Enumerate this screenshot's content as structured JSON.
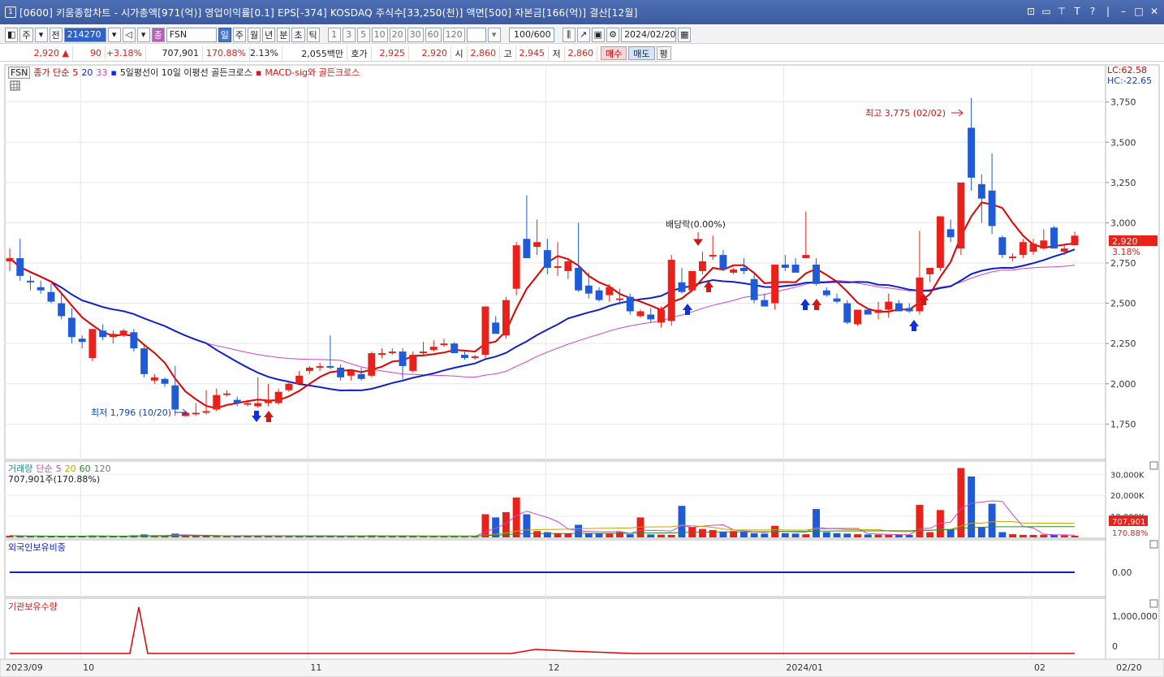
{
  "window": {
    "icon_label": "1",
    "title": "[0600] 키움종합차트 - 시가총액[971(억)] 영업이익률[0.1] EPS[-374] KOSDAQ 주식수[33,250(천)] 액면[500] 자본금[166(억)] 결산[12월]"
  },
  "toolbar": {
    "period_label": "주",
    "prev_label": "전",
    "code_value": "214270",
    "stock_badge": "종",
    "stock_name": "FSN",
    "periods": [
      "일",
      "주",
      "월",
      "년",
      "분",
      "초",
      "틱"
    ],
    "active_period": "일",
    "intervals": [
      "1",
      "3",
      "5",
      "10",
      "20",
      "30",
      "60",
      "120"
    ],
    "count_value": "100/600",
    "date_value": "2024/02/20"
  },
  "pricebar": {
    "price": "2,920",
    "change": "90",
    "change_pct": "+3.18%",
    "volume": "707,901",
    "volume_ratio": "170.88%",
    "turnover": "2.13%",
    "amount": "2,055백만",
    "quote_label": "호가",
    "ask": "2,925",
    "bid": "2,920",
    "open_label": "시",
    "open": "2,860",
    "high_label": "고",
    "high": "2,945",
    "low_label": "저",
    "low": "2,860",
    "buy_label": "매수",
    "sell_label": "매도",
    "flat_label": "평"
  },
  "price_panel": {
    "ticker": "FSN",
    "ma_label": "종가 단순",
    "ma_periods": [
      "5",
      "20",
      "33"
    ],
    "signal1": "5일평선이 10일 이평선 골든크로스",
    "signal2": "MACD-sig와 골든크로스",
    "lc": "LC:62.58",
    "hc": "HC:-22.65",
    "high_annotation": "최고 3,775 (02/02)",
    "low_annotation": "최저 1,796 (10/20)",
    "dividend_annotation": "배당락(0.00%)",
    "current_label": "2,920",
    "current_pct": "3.18%"
  },
  "volume_panel": {
    "title": "거래량",
    "ma_label": "단순",
    "ma_periods": [
      "5",
      "20",
      "60",
      "120"
    ],
    "summary": "707,901주(170.88%)",
    "current_label": "707,901",
    "current_pct": "170.88%"
  },
  "foreign_panel": {
    "title": "외국인보유비중"
  },
  "inst_panel": {
    "title": "기관보유수량"
  },
  "x_axis": {
    "labels": [
      "2023/09",
      "10",
      "11",
      "12",
      "2024/01",
      "02",
      "02/20"
    ]
  },
  "colors": {
    "up": "#e8211a",
    "down": "#1f5bd6",
    "ma5": "#e00000",
    "ma20": "#1020c8",
    "ma33": "#cc44cc",
    "title_bg": "#3b5aa0"
  },
  "chart_data": {
    "type": "candlestick",
    "price_axis": {
      "ticks": [
        "1,750",
        "2,000",
        "2,250",
        "2,500",
        "2,750",
        "3,000",
        "3,250",
        "3,500",
        "3,750"
      ],
      "range": [
        1540,
        3950
      ]
    },
    "volume_axis": {
      "ticks": [
        "10,000K",
        "20,000K",
        "30,000K"
      ],
      "range": [
        0,
        34000
      ]
    },
    "foreign_axis": {
      "ticks": [
        "0.00"
      ]
    },
    "inst_axis": {
      "ticks": [
        "0",
        "1,000,000"
      ]
    },
    "candles": [
      {
        "o": 2760,
        "h": 2840,
        "l": 2700,
        "c": 2780
      },
      {
        "o": 2780,
        "h": 2900,
        "l": 2640,
        "c": 2670
      },
      {
        "o": 2640,
        "h": 2670,
        "l": 2580,
        "c": 2630
      },
      {
        "o": 2600,
        "h": 2640,
        "l": 2560,
        "c": 2580
      },
      {
        "o": 2570,
        "h": 2620,
        "l": 2500,
        "c": 2510
      },
      {
        "o": 2500,
        "h": 2560,
        "l": 2400,
        "c": 2420
      },
      {
        "o": 2410,
        "h": 2470,
        "l": 2250,
        "c": 2290
      },
      {
        "o": 2280,
        "h": 2300,
        "l": 2220,
        "c": 2260
      },
      {
        "o": 2160,
        "h": 2340,
        "l": 2140,
        "c": 2340
      },
      {
        "o": 2330,
        "h": 2370,
        "l": 2270,
        "c": 2290
      },
      {
        "o": 2290,
        "h": 2330,
        "l": 2250,
        "c": 2310
      },
      {
        "o": 2310,
        "h": 2340,
        "l": 2290,
        "c": 2330
      },
      {
        "o": 2320,
        "h": 2340,
        "l": 2200,
        "c": 2220
      },
      {
        "o": 2220,
        "h": 2240,
        "l": 2040,
        "c": 2060
      },
      {
        "o": 2020,
        "h": 2060,
        "l": 2000,
        "c": 2040
      },
      {
        "o": 2030,
        "h": 2040,
        "l": 1980,
        "c": 2000
      },
      {
        "o": 1990,
        "h": 2110,
        "l": 1800,
        "c": 1840
      },
      {
        "o": 1800,
        "h": 1830,
        "l": 1796,
        "c": 1820
      },
      {
        "o": 1810,
        "h": 1880,
        "l": 1800,
        "c": 1820
      },
      {
        "o": 1820,
        "h": 1960,
        "l": 1810,
        "c": 1830
      },
      {
        "o": 1840,
        "h": 1970,
        "l": 1830,
        "c": 1930
      },
      {
        "o": 1930,
        "h": 1960,
        "l": 1920,
        "c": 1940
      },
      {
        "o": 1900,
        "h": 1920,
        "l": 1860,
        "c": 1880
      },
      {
        "o": 1870,
        "h": 1900,
        "l": 1860,
        "c": 1880
      },
      {
        "o": 1860,
        "h": 2040,
        "l": 1850,
        "c": 1880
      },
      {
        "o": 1880,
        "h": 2000,
        "l": 1860,
        "c": 1900
      },
      {
        "o": 1880,
        "h": 1970,
        "l": 1870,
        "c": 1950
      },
      {
        "o": 1960,
        "h": 2020,
        "l": 1950,
        "c": 2000
      },
      {
        "o": 2000,
        "h": 2080,
        "l": 1990,
        "c": 2050
      },
      {
        "o": 2080,
        "h": 2110,
        "l": 2060,
        "c": 2100
      },
      {
        "o": 2100,
        "h": 2130,
        "l": 2080,
        "c": 2110
      },
      {
        "o": 2110,
        "h": 2300,
        "l": 2090,
        "c": 2100
      },
      {
        "o": 2100,
        "h": 2120,
        "l": 2020,
        "c": 2040
      },
      {
        "o": 2050,
        "h": 2070,
        "l": 2020,
        "c": 2080
      },
      {
        "o": 2060,
        "h": 2100,
        "l": 2020,
        "c": 2030
      },
      {
        "o": 2050,
        "h": 2200,
        "l": 2040,
        "c": 2190
      },
      {
        "o": 2180,
        "h": 2220,
        "l": 2160,
        "c": 2190
      },
      {
        "o": 2190,
        "h": 2220,
        "l": 2180,
        "c": 2200
      },
      {
        "o": 2200,
        "h": 2220,
        "l": 2030,
        "c": 2110
      },
      {
        "o": 2080,
        "h": 2200,
        "l": 2070,
        "c": 2180
      },
      {
        "o": 2190,
        "h": 2260,
        "l": 2180,
        "c": 2200
      },
      {
        "o": 2210,
        "h": 2270,
        "l": 2200,
        "c": 2230
      },
      {
        "o": 2240,
        "h": 2280,
        "l": 2230,
        "c": 2250
      },
      {
        "o": 2250,
        "h": 2260,
        "l": 2190,
        "c": 2190
      },
      {
        "o": 2180,
        "h": 2200,
        "l": 2150,
        "c": 2160
      },
      {
        "o": 2160,
        "h": 2180,
        "l": 2150,
        "c": 2170
      },
      {
        "o": 2180,
        "h": 2460,
        "l": 2160,
        "c": 2480
      },
      {
        "o": 2380,
        "h": 2420,
        "l": 2320,
        "c": 2310
      },
      {
        "o": 2300,
        "h": 2540,
        "l": 2280,
        "c": 2520
      },
      {
        "o": 2590,
        "h": 2880,
        "l": 2550,
        "c": 2860
      },
      {
        "o": 2900,
        "h": 3170,
        "l": 2800,
        "c": 2780
      },
      {
        "o": 2850,
        "h": 3020,
        "l": 2800,
        "c": 2880
      },
      {
        "o": 2830,
        "h": 2900,
        "l": 2680,
        "c": 2720
      },
      {
        "o": 2720,
        "h": 2880,
        "l": 2670,
        "c": 2730
      },
      {
        "o": 2700,
        "h": 2780,
        "l": 2650,
        "c": 2760
      },
      {
        "o": 2720,
        "h": 3000,
        "l": 2570,
        "c": 2580
      },
      {
        "o": 2610,
        "h": 2690,
        "l": 2530,
        "c": 2560
      },
      {
        "o": 2580,
        "h": 2600,
        "l": 2510,
        "c": 2520
      },
      {
        "o": 2550,
        "h": 2620,
        "l": 2510,
        "c": 2600
      },
      {
        "o": 2520,
        "h": 2590,
        "l": 2490,
        "c": 2530
      },
      {
        "o": 2540,
        "h": 2560,
        "l": 2430,
        "c": 2450
      },
      {
        "o": 2420,
        "h": 2460,
        "l": 2410,
        "c": 2450
      },
      {
        "o": 2430,
        "h": 2470,
        "l": 2380,
        "c": 2400
      },
      {
        "o": 2380,
        "h": 2480,
        "l": 2350,
        "c": 2460
      },
      {
        "o": 2390,
        "h": 2800,
        "l": 2360,
        "c": 2770
      },
      {
        "o": 2630,
        "h": 2720,
        "l": 2560,
        "c": 2570
      },
      {
        "o": 2580,
        "h": 2700,
        "l": 2570,
        "c": 2700
      },
      {
        "o": 2700,
        "h": 2820,
        "l": 2680,
        "c": 2760
      },
      {
        "o": 2790,
        "h": 2920,
        "l": 2770,
        "c": 2800
      },
      {
        "o": 2800,
        "h": 2830,
        "l": 2720,
        "c": 2710
      },
      {
        "o": 2690,
        "h": 2720,
        "l": 2680,
        "c": 2710
      },
      {
        "o": 2720,
        "h": 2780,
        "l": 2680,
        "c": 2700
      },
      {
        "o": 2650,
        "h": 2680,
        "l": 2500,
        "c": 2520
      },
      {
        "o": 2520,
        "h": 2560,
        "l": 2480,
        "c": 2480
      },
      {
        "o": 2500,
        "h": 2740,
        "l": 2460,
        "c": 2740
      },
      {
        "o": 2740,
        "h": 2800,
        "l": 2700,
        "c": 2720
      },
      {
        "o": 2740,
        "h": 2780,
        "l": 2700,
        "c": 2690
      },
      {
        "o": 2780,
        "h": 3070,
        "l": 2780,
        "c": 2800
      },
      {
        "o": 2740,
        "h": 2780,
        "l": 2610,
        "c": 2620
      },
      {
        "o": 2580,
        "h": 2600,
        "l": 2540,
        "c": 2550
      },
      {
        "o": 2530,
        "h": 2560,
        "l": 2500,
        "c": 2510
      },
      {
        "o": 2500,
        "h": 2520,
        "l": 2370,
        "c": 2380
      },
      {
        "o": 2370,
        "h": 2400,
        "l": 2360,
        "c": 2460
      },
      {
        "o": 2460,
        "h": 2470,
        "l": 2430,
        "c": 2430
      },
      {
        "o": 2440,
        "h": 2510,
        "l": 2400,
        "c": 2460
      },
      {
        "o": 2460,
        "h": 2560,
        "l": 2410,
        "c": 2510
      },
      {
        "o": 2500,
        "h": 2520,
        "l": 2460,
        "c": 2450
      },
      {
        "o": 2470,
        "h": 2500,
        "l": 2440,
        "c": 2450
      },
      {
        "o": 2450,
        "h": 2950,
        "l": 2430,
        "c": 2660
      },
      {
        "o": 2680,
        "h": 2720,
        "l": 2630,
        "c": 2720
      },
      {
        "o": 2720,
        "h": 2870,
        "l": 2700,
        "c": 3040
      },
      {
        "o": 2960,
        "h": 3020,
        "l": 2880,
        "c": 2910
      },
      {
        "o": 2840,
        "h": 3230,
        "l": 2800,
        "c": 3250
      },
      {
        "o": 3590,
        "h": 3775,
        "l": 3200,
        "c": 3280
      },
      {
        "o": 3240,
        "h": 3300,
        "l": 3000,
        "c": 3150
      },
      {
        "o": 3200,
        "h": 3430,
        "l": 2930,
        "c": 2980
      },
      {
        "o": 2910,
        "h": 2920,
        "l": 2780,
        "c": 2800
      },
      {
        "o": 2780,
        "h": 2810,
        "l": 2760,
        "c": 2790
      },
      {
        "o": 2800,
        "h": 2900,
        "l": 2780,
        "c": 2880
      },
      {
        "o": 2820,
        "h": 2900,
        "l": 2800,
        "c": 2870
      },
      {
        "o": 2840,
        "h": 2960,
        "l": 2830,
        "c": 2890
      },
      {
        "o": 2970,
        "h": 2980,
        "l": 2840,
        "c": 2840
      },
      {
        "o": 2820,
        "h": 2860,
        "l": 2800,
        "c": 2840
      },
      {
        "o": 2860,
        "h": 2945,
        "l": 2860,
        "c": 2920
      }
    ],
    "volume_values": [
      800,
      600,
      500,
      500,
      500,
      500,
      700,
      500,
      900,
      500,
      400,
      500,
      1000,
      1400,
      900,
      700,
      1800,
      1100,
      700,
      600,
      500,
      600,
      700,
      700,
      800,
      700,
      500,
      500,
      500,
      500,
      600,
      500,
      600,
      500,
      500,
      1000,
      600,
      500,
      700,
      500,
      400,
      500,
      500,
      500,
      400,
      400,
      11000,
      9500,
      12000,
      19000,
      11000,
      3000,
      2500,
      2000,
      1800,
      6000,
      2000,
      1800,
      1700,
      2500,
      1500,
      9500,
      1400,
      1300,
      1200,
      15000,
      5000,
      4000,
      3500,
      2500,
      3000,
      2500,
      2000,
      1800,
      5500,
      2000,
      1800,
      1500,
      13500,
      2500,
      2000,
      1800,
      1500,
      1400,
      1300,
      1200,
      1200,
      1200,
      15500,
      2500,
      13000,
      4000,
      33000,
      29000,
      5000,
      16000,
      2500,
      1500,
      1200,
      1200,
      1300,
      1200,
      1000,
      800
    ]
  }
}
